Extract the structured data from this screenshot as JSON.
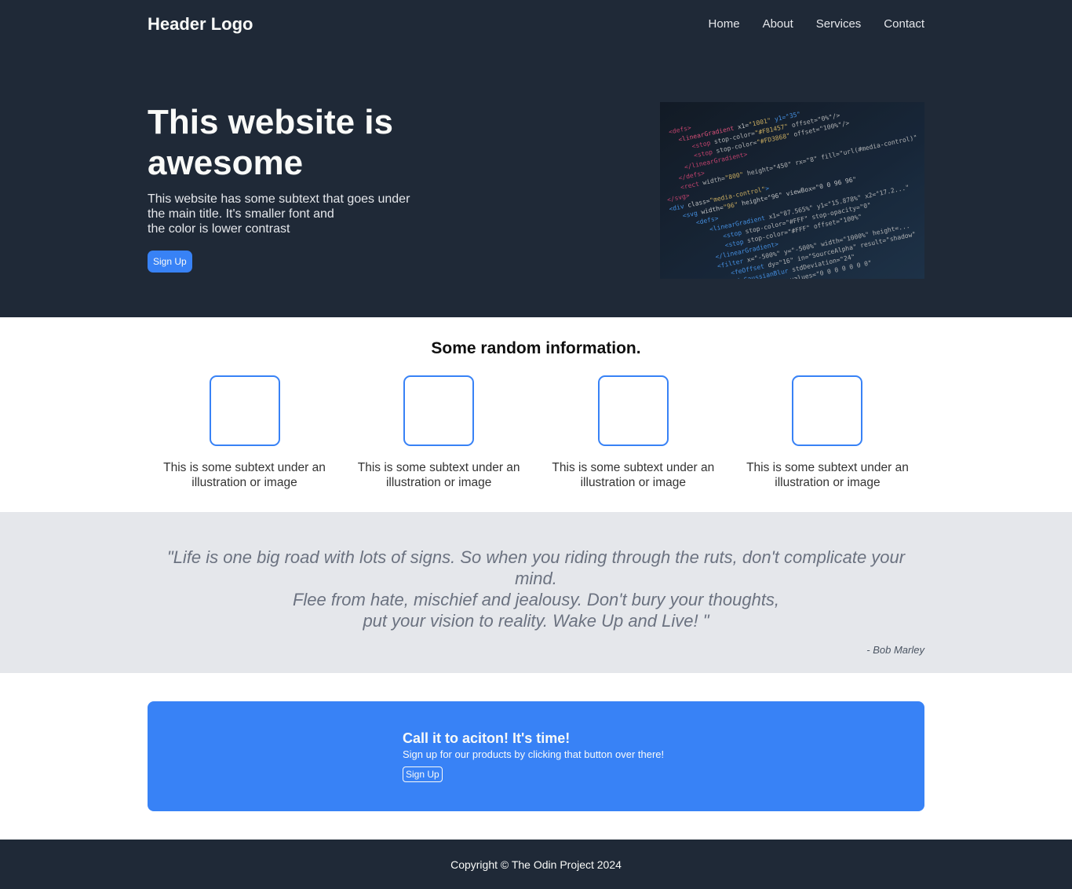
{
  "header": {
    "logo": "Header Logo",
    "nav": [
      "Home",
      "About",
      "Services",
      "Contact"
    ]
  },
  "hero": {
    "title": "This website is awesome",
    "subtext": "This website has some subtext that goes under\nthe main title. It's smaller font and\nthe color is lower contrast",
    "button_label": "Sign Up"
  },
  "info": {
    "title": "Some random information.",
    "cards": [
      {
        "text": "This is some subtext under an illustration or image"
      },
      {
        "text": "This is some subtext under an illustration or image"
      },
      {
        "text": "This is some subtext under an illustration or image"
      },
      {
        "text": "This is some subtext under an illustration or image"
      }
    ]
  },
  "quote": {
    "text": "\"Life is one big road with lots of signs. So when you riding through the ruts, don't complicate your mind.\nFlee from hate, mischief and jealousy. Don't bury your thoughts,\nput your vision to reality. Wake Up and Live! \"",
    "author": "- Bob Marley"
  },
  "cta": {
    "title": "Call it to aciton! It's time!",
    "subtext": "Sign up for our products by clicking that button over there!",
    "button_label": "Sign Up"
  },
  "footer": {
    "copyright": "Copyright © The Odin Project 2024"
  },
  "colors": {
    "dark_bg": "#1f2937",
    "accent": "#3882f6",
    "quote_bg": "#e5e7eb"
  }
}
